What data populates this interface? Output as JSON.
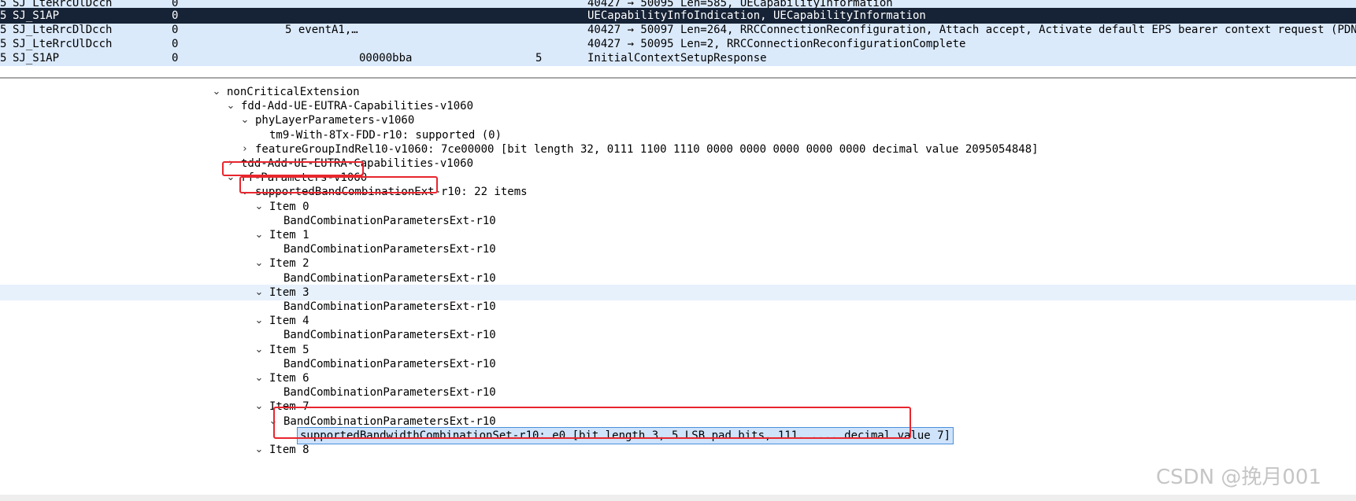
{
  "packet_list": {
    "rows": [
      {
        "mark": "5",
        "proto": "SJ_LteRrcUlDcch",
        "num": "0",
        "events": "",
        "hex": "",
        "n": "",
        "info": "40427 → 50095 Len=585, UECapabilityInformation",
        "selected": false
      },
      {
        "mark": "5",
        "proto": "SJ_S1AP",
        "num": "0",
        "events": "",
        "hex": "",
        "n": "",
        "info": "UECapabilityInfoIndication, UECapabilityInformation",
        "selected": true
      },
      {
        "mark": "5",
        "proto": "SJ_LteRrcDlDcch",
        "num": "0",
        "events": "5 eventA1,…",
        "hex": "",
        "n": "",
        "info": "40427 → 50097 Len=264, RRCConnectionReconfiguration, Attach accept, Activate default EPS bearer context request (PDN type",
        "selected": false
      },
      {
        "mark": "5",
        "proto": "SJ_LteRrcUlDcch",
        "num": "0",
        "events": "",
        "hex": "",
        "n": "",
        "info": "40427 → 50095 Len=2, RRCConnectionReconfigurationComplete",
        "selected": false
      },
      {
        "mark": "5",
        "proto": "SJ_S1AP",
        "num": "0",
        "events": "",
        "hex": "00000bba",
        "n": "5",
        "info": "InitialContextSetupResponse",
        "selected": false
      }
    ]
  },
  "detail_tree": {
    "rows": [
      {
        "chev": "down",
        "text": "nonCriticalExtension"
      },
      {
        "chev": "down",
        "text": "fdd-Add-UE-EUTRA-Capabilities-v1060"
      },
      {
        "chev": "down",
        "text": "phyLayerParameters-v1060"
      },
      {
        "chev": "",
        "text": "tm9-With-8Tx-FDD-r10: supported (0)"
      },
      {
        "chev": "right",
        "text": "featureGroupIndRel10-v1060: 7ce00000 [bit length 32, 0111 1100  1110 0000  0000 0000  0000 0000 decimal value 2095054848]"
      },
      {
        "chev": "right",
        "text": "tdd-Add-UE-EUTRA-Capabilities-v1060"
      },
      {
        "chev": "down",
        "text": "rf-Parameters-v1060"
      },
      {
        "chev": "down",
        "text": "supportedBandCombinationExt-r10: 22 items"
      },
      {
        "chev": "down",
        "text": "Item 0"
      },
      {
        "chev": "",
        "text": "BandCombinationParametersExt-r10"
      },
      {
        "chev": "down",
        "text": "Item 1"
      },
      {
        "chev": "",
        "text": "BandCombinationParametersExt-r10"
      },
      {
        "chev": "down",
        "text": "Item 2"
      },
      {
        "chev": "",
        "text": "BandCombinationParametersExt-r10"
      },
      {
        "chev": "down",
        "text": "Item 3"
      },
      {
        "chev": "",
        "text": "BandCombinationParametersExt-r10"
      },
      {
        "chev": "down",
        "text": "Item 4"
      },
      {
        "chev": "",
        "text": "BandCombinationParametersExt-r10"
      },
      {
        "chev": "down",
        "text": "Item 5"
      },
      {
        "chev": "",
        "text": "BandCombinationParametersExt-r10"
      },
      {
        "chev": "down",
        "text": "Item 6"
      },
      {
        "chev": "",
        "text": "BandCombinationParametersExt-r10"
      },
      {
        "chev": "down",
        "text": "Item 7"
      },
      {
        "chev": "down",
        "text": "BandCombinationParametersExt-r10"
      },
      {
        "chev": "",
        "text": "supportedBandwidthCombinationSet-r10: e0 [bit length 3, 5 LSB pad bits, 111. .... decimal value 7]"
      },
      {
        "chev": "down",
        "text": "Item 8"
      }
    ]
  },
  "watermark": "CSDN @挽月001",
  "colors": {
    "selected_packet_bg": "#162235",
    "packet_list_bg": "#dbeafb",
    "highlight_box": "#e8262e",
    "selected_field_bg": "#cfe3fb"
  }
}
